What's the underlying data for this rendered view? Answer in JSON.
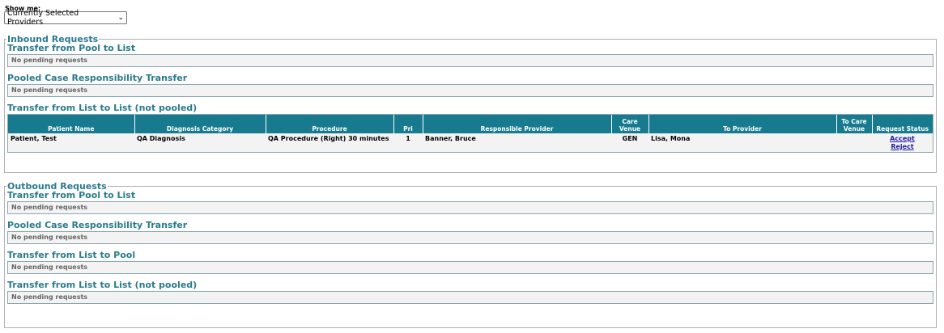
{
  "show_me": {
    "label": "Show me:",
    "selected": "Currently Selected Providers"
  },
  "inbound": {
    "legend": "Inbound Requests",
    "pool_to_list": {
      "title": "Transfer from Pool to List",
      "pending": "No pending requests"
    },
    "pooled_case": {
      "title": "Pooled Case Responsibility Transfer",
      "pending": "No pending requests"
    },
    "list_to_list": {
      "title": "Transfer from List to List (not pooled)",
      "headers": [
        "Patient Name",
        "Diagnosis Category",
        "Procedure",
        "Pri",
        "Responsible Provider",
        "Care Venue",
        "To Provider",
        "To Care Venue",
        "Request Status"
      ],
      "rows": [
        {
          "patient": "Patient, Test",
          "diagnosis": "QA Diagnosis",
          "procedure": "QA Procedure (Right) 30 minutes",
          "pri": "1",
          "responsible": "Banner, Bruce",
          "care_venue": "GEN",
          "to_provider": "Lisa, Mona",
          "to_care_venue": "",
          "accept": "Accept",
          "reject": "Reject"
        }
      ]
    }
  },
  "outbound": {
    "legend": "Outbound Requests",
    "pool_to_list": {
      "title": "Transfer from Pool to List",
      "pending": "No pending requests"
    },
    "pooled_case": {
      "title": "Pooled Case Responsibility Transfer",
      "pending": "No pending requests"
    },
    "list_to_pool": {
      "title": "Transfer from List to Pool",
      "pending": "No pending requests"
    },
    "list_to_list": {
      "title": "Transfer from List to List (not pooled)",
      "pending": "No pending requests"
    }
  },
  "colors": {
    "accent": "#2a7b8e",
    "header_bg": "#187a8e",
    "link": "#1a1aa6"
  }
}
